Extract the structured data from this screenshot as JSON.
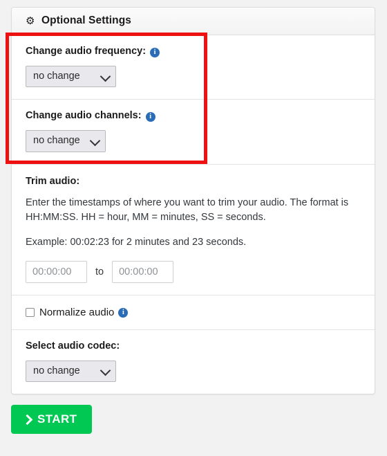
{
  "card": {
    "header": {
      "icon": "gear-icon",
      "title": "Optional Settings"
    },
    "sections": [
      {
        "id": "audio-frequency",
        "label": "Change audio frequency:",
        "info_icon": "info-icon",
        "select_value": "no change",
        "options": [
          "no change"
        ]
      },
      {
        "id": "audio-channels",
        "label": "Change audio channels:",
        "info_icon": "info-icon",
        "select_value": "no change",
        "options": [
          "no change"
        ]
      },
      {
        "id": "trim-audio",
        "heading": "Trim audio:",
        "description_1": "Enter the timestamps of where you want to trim your audio. The format is HH:MM:SS. HH = hour, MM = minutes, SS = seconds.",
        "description_2": "Example: 00:02:23 for 2 minutes and 23 seconds.",
        "start_placeholder": "00:00:00",
        "start_value": "",
        "separator_label": "to",
        "end_placeholder": "00:00:00",
        "end_value": ""
      },
      {
        "id": "normalize-audio",
        "label": "Normalize audio",
        "info_icon": "info-icon",
        "checked": false
      },
      {
        "id": "audio-codec",
        "label": "Select audio codec:",
        "select_value": "no change",
        "options": [
          "no change"
        ]
      }
    ]
  },
  "start_button": {
    "label": "START",
    "icon": "chevron-right-icon"
  },
  "annotation": {
    "type": "red-highlight-rectangle",
    "color": "#ee1111"
  },
  "colors": {
    "page_background": "#f2f2f2",
    "card_background": "#ffffff",
    "card_border": "#dcdcdc",
    "header_background": "#f5f5f5",
    "info_icon": "#2b6cb8",
    "start_button": "#00c853",
    "annotation": "#ee1111",
    "select_background": "#e9e9ed",
    "divider": "#e3e3e3"
  }
}
